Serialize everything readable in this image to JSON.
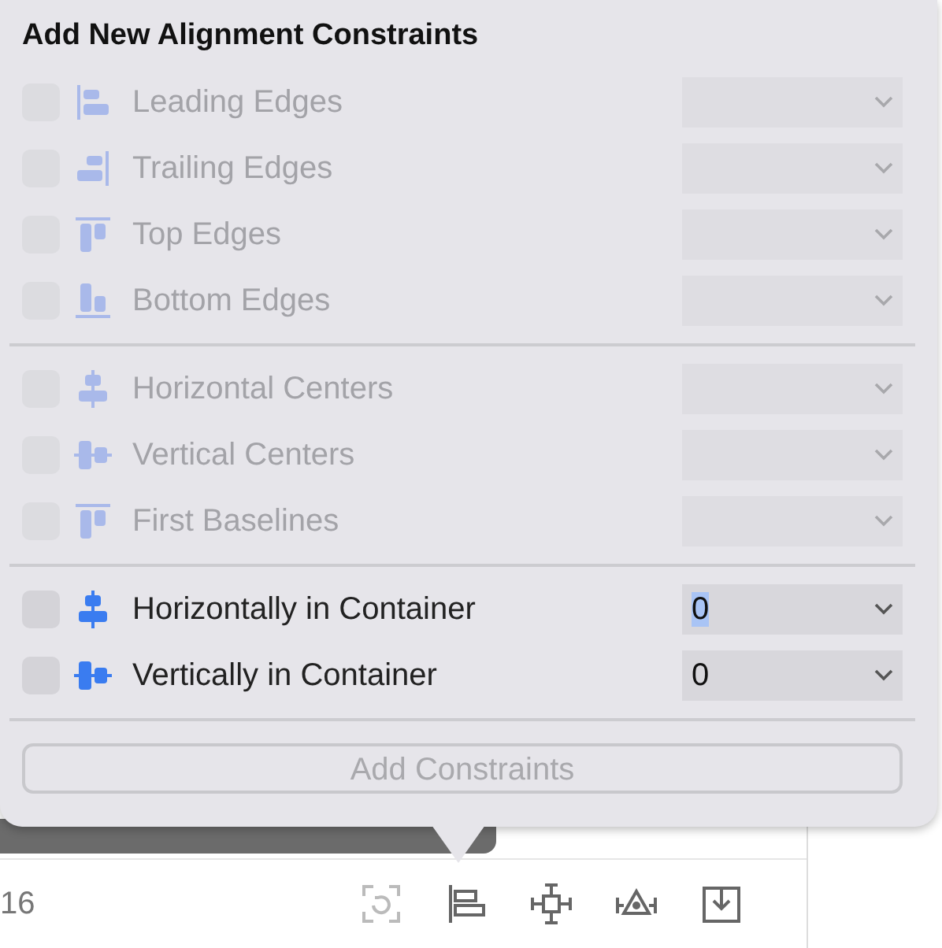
{
  "popover": {
    "title": "Add New Alignment Constraints",
    "groups": [
      {
        "rows": [
          {
            "kind": "leading",
            "label": "Leading Edges",
            "disabled": true,
            "checked": false,
            "value": ""
          },
          {
            "kind": "trailing",
            "label": "Trailing Edges",
            "disabled": true,
            "checked": false,
            "value": ""
          },
          {
            "kind": "top",
            "label": "Top Edges",
            "disabled": true,
            "checked": false,
            "value": ""
          },
          {
            "kind": "bottom",
            "label": "Bottom Edges",
            "disabled": true,
            "checked": false,
            "value": ""
          }
        ]
      },
      {
        "rows": [
          {
            "kind": "hcenter",
            "label": "Horizontal Centers",
            "disabled": true,
            "checked": false,
            "value": ""
          },
          {
            "kind": "vcenter",
            "label": "Vertical Centers",
            "disabled": true,
            "checked": false,
            "value": ""
          },
          {
            "kind": "baseline",
            "label": "First Baselines",
            "disabled": true,
            "checked": false,
            "value": ""
          }
        ]
      },
      {
        "rows": [
          {
            "kind": "hcenter",
            "label": "Horizontally in Container",
            "disabled": false,
            "checked": false,
            "value": "0",
            "text_selected": true
          },
          {
            "kind": "vcenter",
            "label": "Vertically in Container",
            "disabled": false,
            "checked": false,
            "value": "0",
            "text_selected": false
          }
        ]
      }
    ],
    "button": {
      "label": "Add Constraints",
      "disabled": true
    }
  },
  "editor": {
    "line_number": "16"
  },
  "toolbar": [
    {
      "kind": "update"
    },
    {
      "kind": "align"
    },
    {
      "kind": "pin"
    },
    {
      "kind": "resolve"
    },
    {
      "kind": "embed"
    }
  ]
}
